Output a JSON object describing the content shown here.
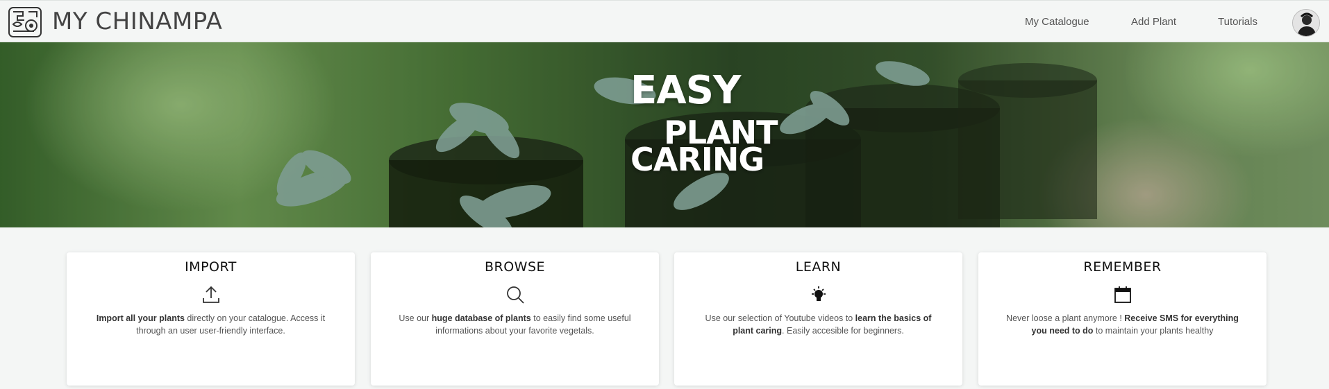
{
  "app": {
    "brand": "MY CHINAMPA",
    "logo": "aztec-glyph-icon"
  },
  "nav": {
    "items": [
      {
        "label": "My Catalogue"
      },
      {
        "label": "Add Plant"
      },
      {
        "label": "Tutorials"
      }
    ],
    "avatar": "user-avatar"
  },
  "hero": {
    "line1": "EASY",
    "line2": "PLANT",
    "line3": "CARING"
  },
  "cards": [
    {
      "title": "IMPORT",
      "icon": "upload-icon",
      "text_bold": "Import all your plants",
      "text_rest": " directly on your catalogue. Access it through an user user-friendly interface."
    },
    {
      "title": "BROWSE",
      "icon": "search-icon",
      "text_pre": "Use our ",
      "text_bold": "huge database of plants",
      "text_rest": " to easily find some useful informations about your favorite vegetals."
    },
    {
      "title": "LEARN",
      "icon": "lightbulb-icon",
      "text_pre": "Use our selection of Youtube videos to ",
      "text_bold": "learn the basics of plant caring",
      "text_rest": ". Easily accesible for beginners."
    },
    {
      "title": "REMEMBER",
      "icon": "calendar-icon",
      "text_pre": "Never loose a plant anymore ! ",
      "text_bold": "Receive SMS for everything you need to do",
      "text_rest": " to maintain your plants healthy"
    }
  ],
  "colors": {
    "header_bg": "#f4f6f5",
    "page_bg": "#f4f6f5",
    "card_bg": "#ffffff",
    "hero_text": "#ffffff"
  }
}
